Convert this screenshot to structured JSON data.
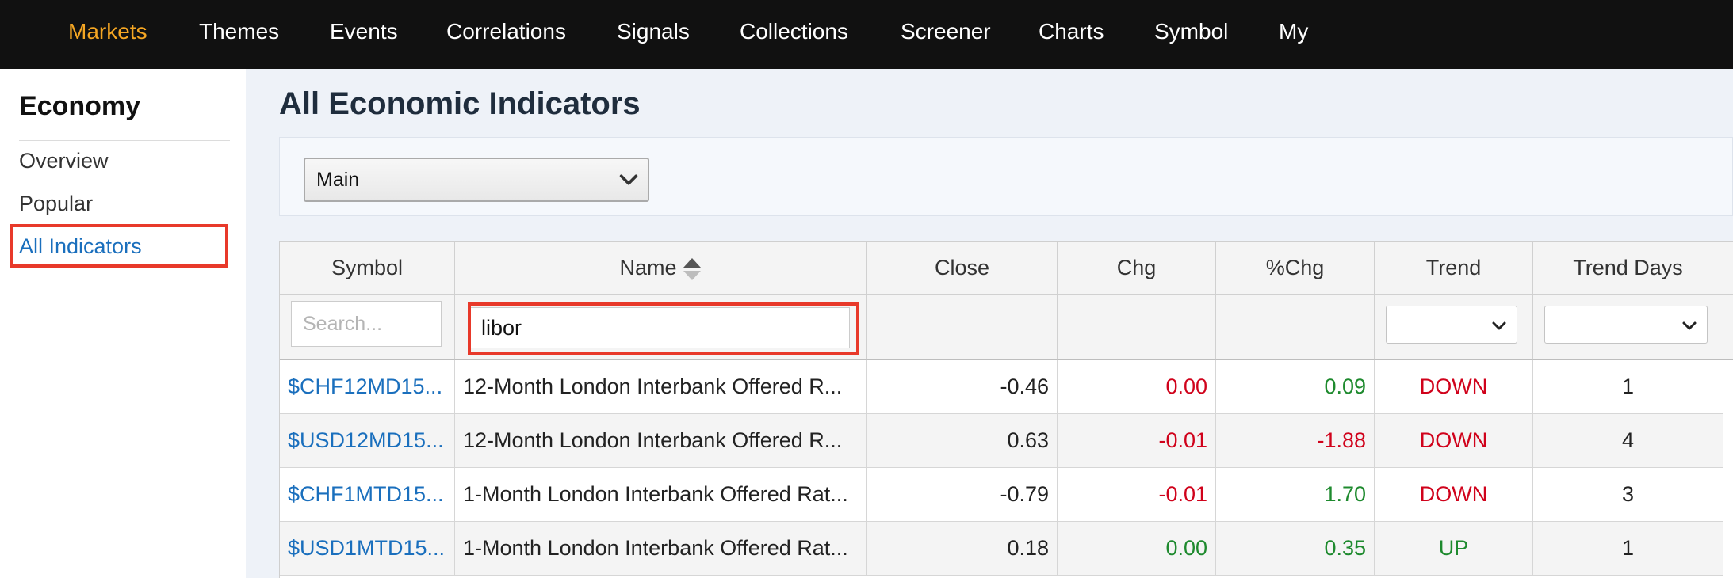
{
  "topnav": {
    "items": [
      {
        "label": "Markets",
        "active": true
      },
      {
        "label": "Themes"
      },
      {
        "label": "Events"
      },
      {
        "label": "Correlations"
      },
      {
        "label": "Signals"
      },
      {
        "label": "Collections"
      },
      {
        "label": "Screener"
      },
      {
        "label": "Charts"
      },
      {
        "label": "Symbol"
      },
      {
        "label": "My"
      }
    ],
    "active_color": "#f5a623"
  },
  "sidebar": {
    "title": "Economy",
    "items": [
      {
        "label": "Overview"
      },
      {
        "label": "Popular"
      },
      {
        "label": "All Indicators",
        "current": true
      }
    ]
  },
  "main": {
    "title": "All Economic Indicators",
    "view_select": {
      "value": "Main"
    }
  },
  "table": {
    "columns": [
      {
        "label": "Symbol"
      },
      {
        "label": "Name",
        "sort_icon": "sort-icon"
      },
      {
        "label": "Close"
      },
      {
        "label": "Chg"
      },
      {
        "label": "%Chg"
      },
      {
        "label": "Trend"
      },
      {
        "label": "Trend Days"
      }
    ],
    "filters": {
      "symbol_placeholder": "Search...",
      "name_value": "libor",
      "trend_value": "",
      "trend_days_value": ""
    },
    "rows": [
      {
        "symbol": "$CHF12MD15...",
        "name": "12-Month London Interbank Offered R...",
        "close": "-0.46",
        "chg": "0.00",
        "pct_chg": "0.09",
        "trend": "DOWN",
        "trend_days": "1"
      },
      {
        "symbol": "$USD12MD15...",
        "name": "12-Month London Interbank Offered R...",
        "close": "0.63",
        "chg": "-0.01",
        "pct_chg": "-1.88",
        "trend": "DOWN",
        "trend_days": "4"
      },
      {
        "symbol": "$CHF1MTD15...",
        "name": "1-Month London Interbank Offered Rat...",
        "close": "-0.79",
        "chg": "-0.01",
        "pct_chg": "1.70",
        "trend": "DOWN",
        "trend_days": "3"
      },
      {
        "symbol": "$USD1MTD15...",
        "name": "1-Month London Interbank Offered Rat...",
        "close": "0.18",
        "chg": "0.00",
        "pct_chg": "0.35",
        "trend": "UP",
        "trend_days": "1"
      }
    ]
  },
  "colors": {
    "link": "#1a6fbd",
    "negative": "#d0021b",
    "positive": "#1e8a2e",
    "highlight": "#e8392a"
  }
}
